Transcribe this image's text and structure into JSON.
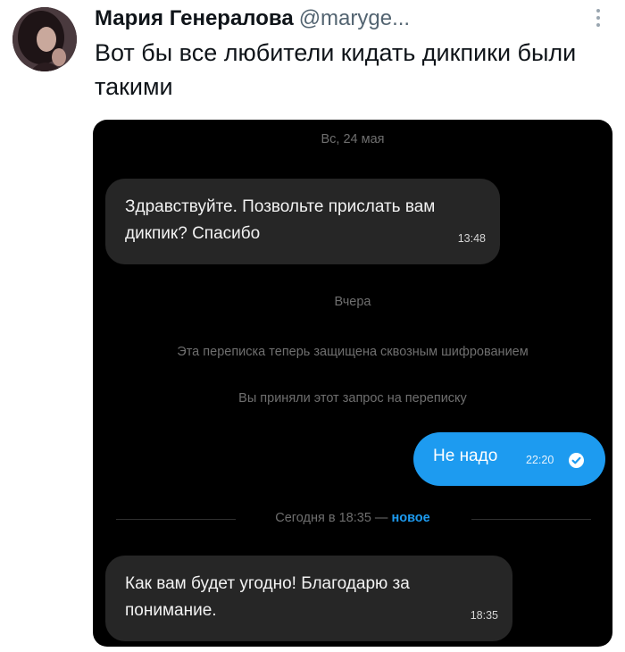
{
  "tweet": {
    "author_name": "Мария Генералова",
    "author_handle": "@maryge...",
    "text": "Вот бы все любители кидать дикпики были такими"
  },
  "icons": {
    "avatar": "profile-photo",
    "more": "more-vertical-icon",
    "read_receipt": "check-circle-icon"
  },
  "chat": {
    "date_1": "Вс, 24 мая",
    "message_1": {
      "text": "Здравствуйте. Позвольте прислать вам дикпик? Спасибо",
      "time": "13:48"
    },
    "date_2": "Вчера",
    "system_encrypted": "Эта переписка теперь защищена сквозным шифрованием",
    "system_accepted": "Вы приняли этот запрос на переписку",
    "message_2": {
      "text": "Не надо",
      "time": "22:20"
    },
    "divider": {
      "label": "Сегодня в 18:35 —",
      "new_label": "новое"
    },
    "message_3": {
      "text": "Как вам будет угодно! Благодарю за понимание.",
      "time": "18:35"
    }
  },
  "colors": {
    "accent": "#1d9bf0",
    "chat_background": "#000000",
    "incoming_bubble": "#262626",
    "system_text": "#6f6f6f",
    "tweet_text": "#0f1419",
    "handle_text": "#536471"
  }
}
